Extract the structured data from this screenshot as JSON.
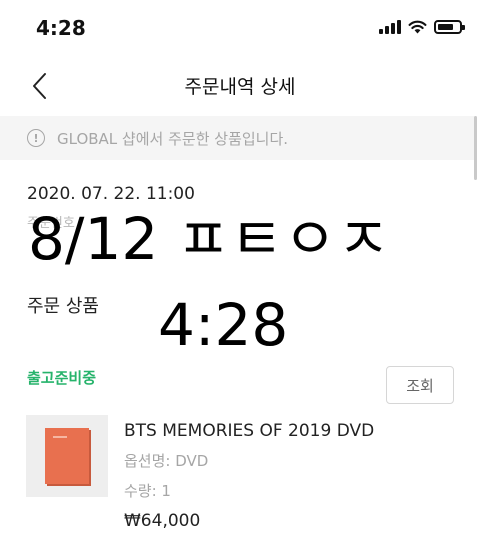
{
  "status_bar": {
    "time": "4:28"
  },
  "header": {
    "title": "주문내역 상세",
    "back_icon": "chevron-left-icon"
  },
  "notice": {
    "text": "GLOBAL 샵에서 주문한 상품입니다.",
    "icon": "info-circle-icon"
  },
  "order": {
    "date": "2020. 07. 22. 11:00",
    "number_label": "주문번호"
  },
  "overlay": {
    "date_text": "8/12 ㅍㅌㅇㅈ",
    "time_text": "4:28"
  },
  "section": {
    "title": "주문 상품"
  },
  "shipment": {
    "status": "출고준비중",
    "status_color": "#26b36b",
    "view_button_label": "조회"
  },
  "product": {
    "name": "BTS MEMORIES OF 2019 DVD",
    "option": "옵션명: DVD",
    "quantity": "수량: 1",
    "price": "₩64,000"
  }
}
